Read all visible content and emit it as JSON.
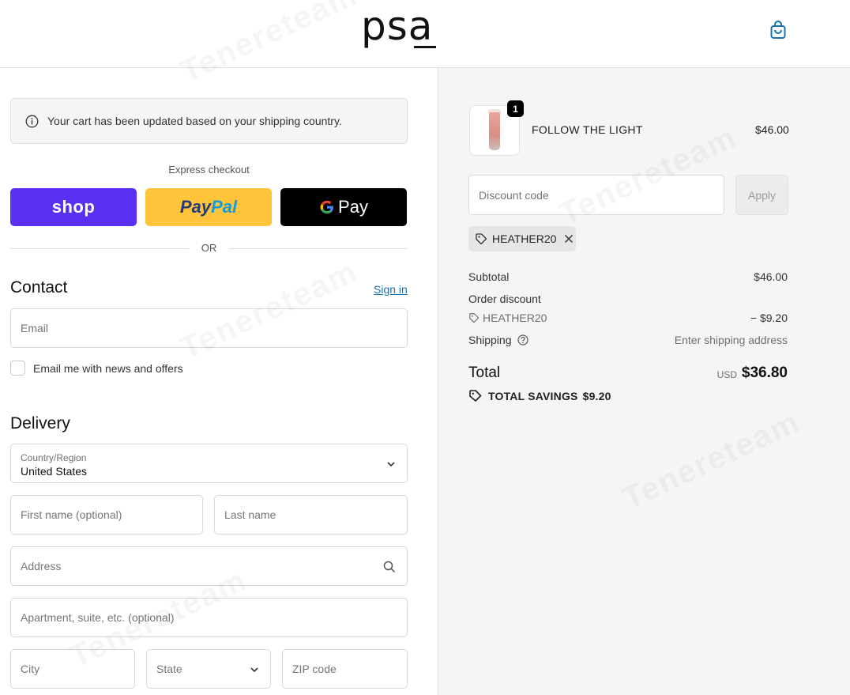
{
  "header": {
    "logo": "psa",
    "cart_icon": "shopping-bag-icon"
  },
  "notice": {
    "icon": "info-circle-icon",
    "text": "Your cart has been updated based on your shipping country."
  },
  "express": {
    "label": "Express checkout",
    "shop_label": "shop",
    "paypal_part1": "Pay",
    "paypal_part2": "Pal",
    "gpay_g": "G",
    "gpay_label": "Pay",
    "or_label": "OR"
  },
  "contact": {
    "title": "Contact",
    "sign_in": "Sign in",
    "email_placeholder": "Email",
    "news_label": "Email me with news and offers"
  },
  "delivery": {
    "title": "Delivery",
    "country_label": "Country/Region",
    "country_value": "United States",
    "first_name_placeholder": "First name (optional)",
    "last_name_placeholder": "Last name",
    "address_placeholder": "Address",
    "apartment_placeholder": "Apartment, suite, etc. (optional)",
    "city_placeholder": "City",
    "state_placeholder": "State",
    "zip_placeholder": "ZIP code"
  },
  "summary": {
    "product_name": "FOLLOW THE LIGHT",
    "product_price": "$46.00",
    "quantity": "1",
    "discount_placeholder": "Discount code",
    "apply_label": "Apply",
    "applied_code": "HEATHER20",
    "subtotal_label": "Subtotal",
    "subtotal_value": "$46.00",
    "order_discount_label": "Order discount",
    "discount_code": "HEATHER20",
    "discount_value": "− $9.20",
    "shipping_label": "Shipping",
    "shipping_value": "Enter shipping address",
    "total_label": "Total",
    "total_currency": "USD",
    "total_value": "$36.80",
    "savings_label": "TOTAL SAVINGS",
    "savings_value": "$9.20"
  },
  "watermark": "Tenereteam"
}
